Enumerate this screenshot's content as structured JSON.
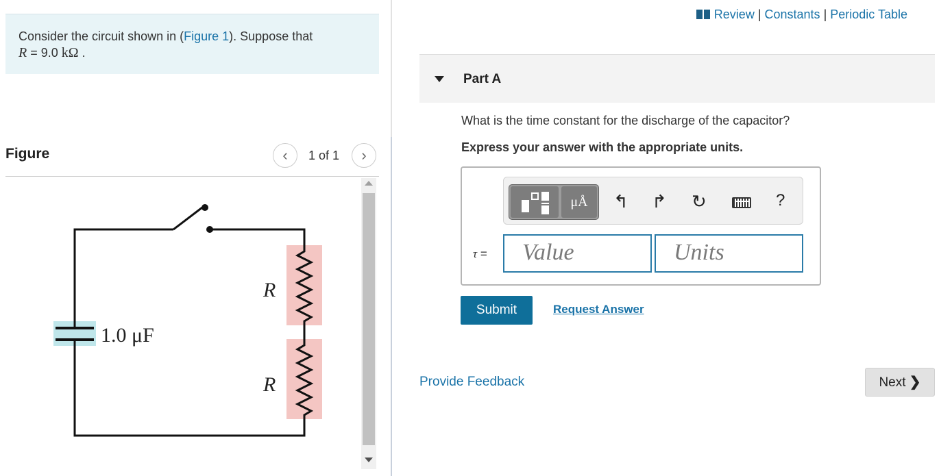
{
  "problem": {
    "text_before": "Consider the circuit shown in (",
    "figure_link": "Figure 1",
    "text_after": "). Suppose that",
    "r_symbol": "R",
    "r_value": " = 9.0  ",
    "r_unit": "kΩ",
    "r_end": " ."
  },
  "figure": {
    "title": "Figure",
    "counter": "1 of 1",
    "prev_icon": "chevron-left-icon",
    "next_icon": "chevron-right-icon",
    "labels": {
      "r_top": "R",
      "r_bottom": "R",
      "capacitor": "1.0 μF"
    }
  },
  "top_links": {
    "review": "Review",
    "sep1": " | ",
    "constants": "Constants",
    "sep2": " | ",
    "periodic_table": "Periodic Table"
  },
  "part": {
    "title": "Part A",
    "question": "What is the time constant for the discharge of the capacitor?",
    "instruction": "Express your answer with the appropriate units."
  },
  "toolbar": {
    "units_button": "μÅ",
    "help": "?"
  },
  "answer": {
    "variable": "τ",
    "equals": " =",
    "value_placeholder": "Value",
    "units_placeholder": "Units"
  },
  "actions": {
    "submit": "Submit",
    "request_answer": "Request Answer",
    "provide_feedback": "Provide Feedback",
    "next": "Next"
  },
  "colors": {
    "link": "#1a73a8",
    "submit_bg": "#0f6f9a",
    "problem_bg": "#e8f4f7",
    "resistor_highlight": "#f4c6c3",
    "capacitor_highlight": "#bfe6ea"
  }
}
